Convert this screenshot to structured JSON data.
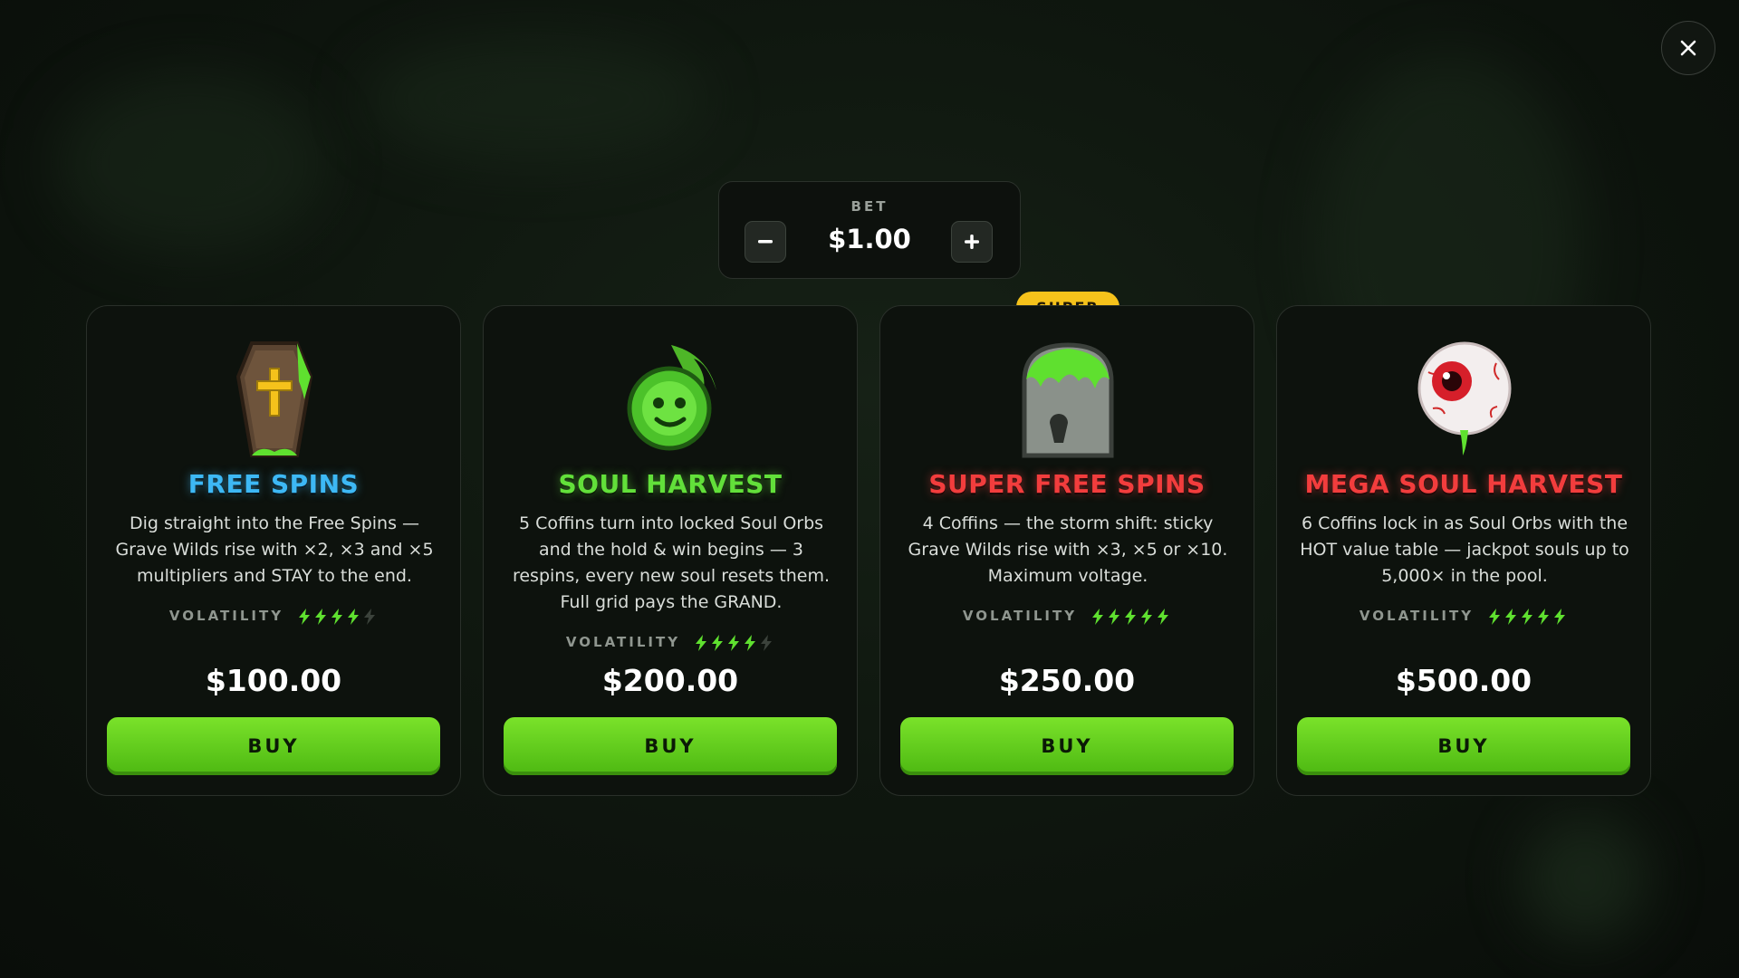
{
  "bet": {
    "label": "BET",
    "value": "$1.00",
    "decrease_label": "−",
    "increase_label": "+"
  },
  "close": {
    "label": "✕",
    "icon": "close-icon"
  },
  "volatility_label": "VOLATILITY",
  "cards": [
    {
      "title": "FREE SPINS",
      "title_color": "#3db8f5",
      "icon": "coffin-icon",
      "description": "Dig straight into the Free Spins — Grave Wilds rise with ×2, ×3 and ×5 multipliers and STAY to the end.",
      "volatility": 4,
      "volatility_max": 5,
      "price": "$100.00",
      "buy_label": "BUY"
    },
    {
      "title": "SOUL HARVEST",
      "title_color": "#62e03a",
      "icon": "soul-orb-icon",
      "description": "5 Coffins turn into locked Soul Orbs and the hold & win begins — 3 respins, every new soul resets them. Full grid pays the GRAND.",
      "volatility": 4,
      "volatility_max": 5,
      "price": "$200.00",
      "buy_label": "BUY"
    },
    {
      "title": "SUPER FREE SPINS",
      "title_color": "#f23d3d",
      "icon": "wild-tombstone-icon",
      "badge": "SUPER",
      "description": "4 Coffins — the storm shift: sticky Grave Wilds rise with ×3, ×5 or ×10. Maximum voltage.",
      "volatility": 5,
      "volatility_max": 5,
      "price": "$250.00",
      "buy_label": "BUY"
    },
    {
      "title": "MEGA SOUL HARVEST",
      "title_color": "#f23d3d",
      "icon": "eyeball-icon",
      "description": "6 Coffins lock in as Soul Orbs with the HOT value table — jackpot souls up to 5,000× in the pool.",
      "volatility": 5,
      "volatility_max": 5,
      "price": "$500.00",
      "buy_label": "BUY"
    }
  ],
  "colors": {
    "bolt_active": "#5fe02f",
    "bolt_inactive": "#3b423b",
    "buy_button": "#62d11c",
    "badge": "#f5c21b"
  }
}
